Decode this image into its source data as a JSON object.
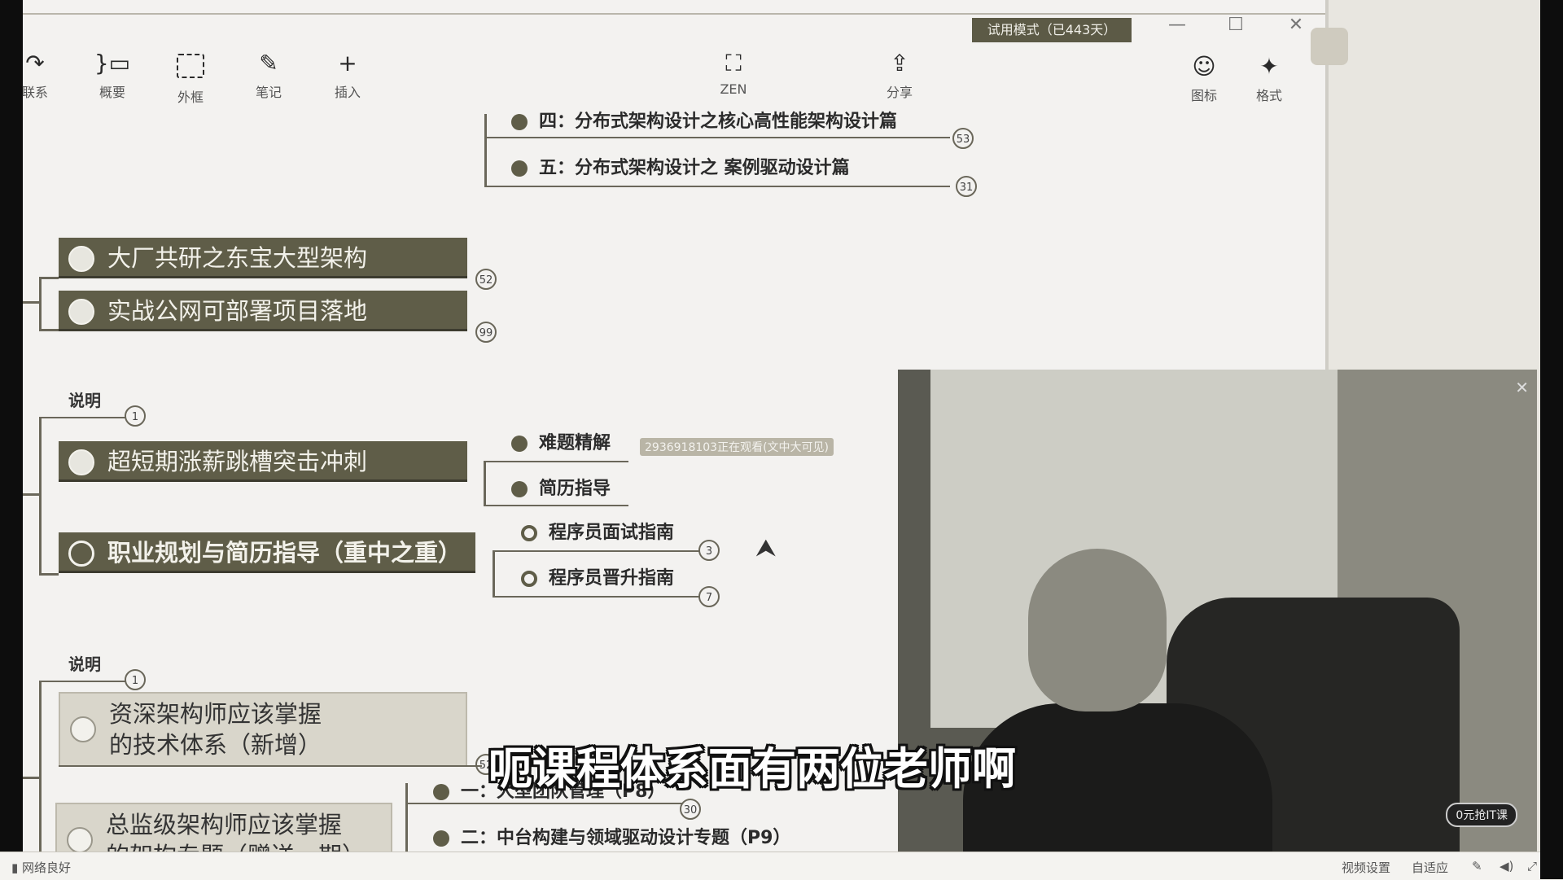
{
  "toolbar": {
    "items": [
      {
        "label": "联系",
        "icon": "relation-icon"
      },
      {
        "label": "概要",
        "icon": "summary-icon"
      },
      {
        "label": "外框",
        "icon": "boundary-icon"
      },
      {
        "label": "笔记",
        "icon": "note-icon"
      },
      {
        "label": "插入",
        "icon": "insert-icon"
      }
    ],
    "zen_label": "ZEN",
    "share_label": "分享",
    "icon_label": "图标",
    "format_label": "格式",
    "trial_badge": "试用模式（已443天）"
  },
  "mindmap": {
    "top_children": [
      {
        "label": "四：分布式架构设计之核心高性能架构设计篇",
        "count": "53"
      },
      {
        "label": "五：分布式架构设计之 案例驱动设计篇",
        "count": "31"
      }
    ],
    "group1": {
      "nodes": [
        "大厂共研之东宝大型架构",
        "实战公网可部署项目落地"
      ],
      "counts": [
        "52",
        "99"
      ]
    },
    "group2": {
      "note_label": "说明",
      "note_count": "1",
      "node1": "超短期涨薪跳槽突击冲刺",
      "node1_children": [
        "难题精解",
        "简历指导"
      ],
      "watching": "2936918103正在观看(文中大可见)",
      "node2": "职业规划与简历指导（重中之重）",
      "node2_children": [
        {
          "label": "程序员面试指南",
          "count": "3"
        },
        {
          "label": "程序员晋升指南",
          "count": "7"
        }
      ]
    },
    "group3": {
      "note_label": "说明",
      "note_count": "1",
      "node1_line1": "资深架构师应该掌握",
      "node1_line2": "的技术体系（新增）",
      "node1_count": "52",
      "node2_line1": "总监级架构师应该掌握",
      "node2_line2": "的架构专题（赠送一期）",
      "node2_children": [
        {
          "label": "一：大型团队管理（P8）",
          "count": "30"
        },
        {
          "label": "二：中台构建与领域驱动设计专题（P9）"
        }
      ]
    }
  },
  "video": {
    "subtitle": "呃课程体系面有两位老师啊",
    "promo_button": "0元抢IT课"
  },
  "bottom_bar": {
    "network": "网络良好",
    "video_settings": "视频设置",
    "adaptive": "自适应"
  }
}
